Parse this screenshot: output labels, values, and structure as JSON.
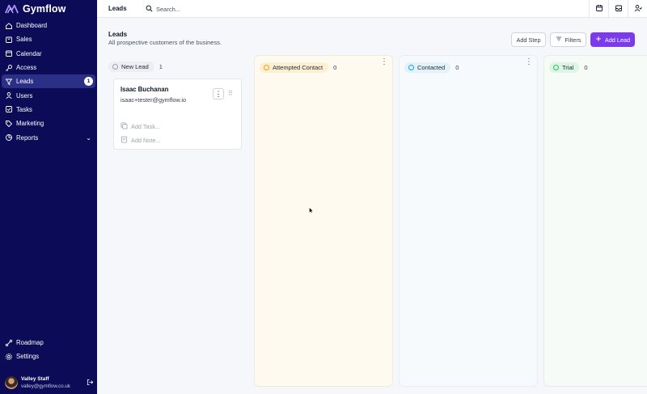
{
  "app": {
    "brand": "Gymflow"
  },
  "sidebar": {
    "items": [
      {
        "label": "Dashboard",
        "icon": "home-icon"
      },
      {
        "label": "Sales",
        "icon": "cart-icon"
      },
      {
        "label": "Calendar",
        "icon": "calendar-icon"
      },
      {
        "label": "Access",
        "icon": "key-icon"
      },
      {
        "label": "Leads",
        "icon": "filter-icon",
        "badge": "1",
        "active": true
      },
      {
        "label": "Users",
        "icon": "users-icon"
      },
      {
        "label": "Tasks",
        "icon": "tasks-icon"
      },
      {
        "label": "Marketing",
        "icon": "tag-icon"
      },
      {
        "label": "Reports",
        "icon": "chart-pie-icon"
      }
    ],
    "bottom_items": [
      {
        "label": "Roadmap",
        "icon": "roadmap-icon"
      },
      {
        "label": "Settings",
        "icon": "gear-icon"
      }
    ],
    "user": {
      "name": "Valley Staff",
      "email": "valley@gymflow.co.uk"
    }
  },
  "topbar": {
    "breadcrumb": "Leads",
    "search_placeholder": "Search...",
    "icons": [
      "calendar-icon",
      "inbox-icon",
      "user-settings-icon"
    ]
  },
  "header": {
    "title": "Leads",
    "subtitle": "All prospective customers of the business.",
    "add_step_label": "Add Step",
    "filters_label": "Filters",
    "add_lead_label": "Add Lead"
  },
  "columns": [
    {
      "title": "New Lead",
      "count": "1",
      "dot_color": "#9ca3af",
      "pill_bg": "#eceef2",
      "col_bg": "#f5f7fb"
    },
    {
      "title": "Attempted Contact",
      "count": "0",
      "dot_color": "#f59e0b",
      "pill_bg": "#fdf0d2",
      "col_bg": "#fffaf0"
    },
    {
      "title": "Contacted",
      "count": "0",
      "dot_color": "#0ea5e9",
      "pill_bg": "#e3f1fb",
      "col_bg": "#f7fafd"
    },
    {
      "title": "Trial",
      "count": "0",
      "dot_color": "#22c55e",
      "pill_bg": "#dcf5e4",
      "col_bg": "#f6fbf8"
    }
  ],
  "card": {
    "name": "Isaac Buchanan",
    "email": "isaac+tester@gymflow.io",
    "add_task_label": "Add Task...",
    "add_note_label": "Add Note..."
  },
  "colors": {
    "sidebar_bg": "#0b0b57",
    "accent": "#7c3aed",
    "active_nav_bg": "#2b2f86"
  }
}
